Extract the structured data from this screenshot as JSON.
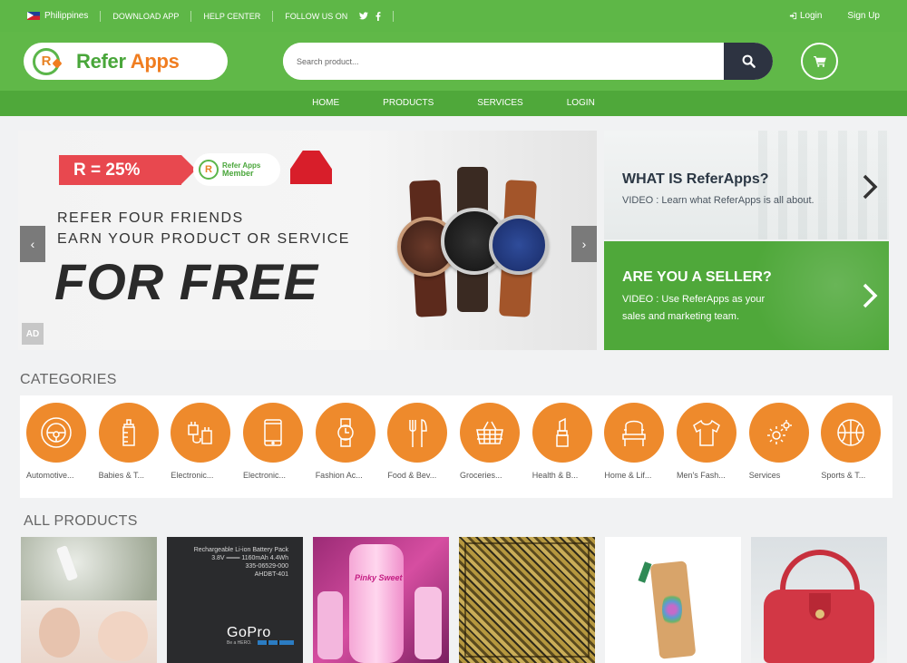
{
  "topbar": {
    "country": "Philippines",
    "download_app": "DOWNLOAD APP",
    "help_center": "HELP CENTER",
    "follow_us": "FOLLOW US ON",
    "twitter_icon": "twitter-icon",
    "facebook_icon": "facebook-icon",
    "login": "Login",
    "signup": "Sign Up"
  },
  "header": {
    "logo_refer": "Refer",
    "logo_apps": "Apps",
    "logo_mark": "R",
    "search_placeholder": "Search product...",
    "search_icon": "search-icon",
    "cart_icon": "cart-icon"
  },
  "nav": {
    "items": [
      "HOME",
      "PRODUCTS",
      "SERVICES",
      "LOGIN"
    ]
  },
  "banner": {
    "rate": "R = 25%",
    "member_line1": "Refer Apps",
    "member_line2": "Member",
    "line1": "REFER FOUR FRIENDS",
    "line2": "EARN YOUR PRODUCT OR SERVICE",
    "headline": "FOR FREE",
    "ad": "AD"
  },
  "side": {
    "what_title": "WHAT IS ReferApps?",
    "what_text": "VIDEO : Learn what ReferApps is all about.",
    "seller_title": "ARE YOU A SELLER?",
    "seller_text1": "VIDEO : Use ReferApps as your",
    "seller_text2": "sales and marketing team."
  },
  "categories": {
    "title": "CATEGORIES",
    "items": [
      {
        "label": "Automotive...",
        "icon": "steering-wheel-icon"
      },
      {
        "label": "Babies & T...",
        "icon": "baby-bottle-icon"
      },
      {
        "label": "Electronic...",
        "icon": "plug-icon"
      },
      {
        "label": "Electronic...",
        "icon": "tablet-icon"
      },
      {
        "label": "Fashion Ac...",
        "icon": "watch-icon"
      },
      {
        "label": "Food & Bev...",
        "icon": "fork-knife-icon"
      },
      {
        "label": "Groceries...",
        "icon": "basket-icon"
      },
      {
        "label": "Health & B...",
        "icon": "lipstick-icon"
      },
      {
        "label": "Home & Lif...",
        "icon": "chair-icon"
      },
      {
        "label": "Men's Fash...",
        "icon": "shirt-icon"
      },
      {
        "label": "Services",
        "icon": "gear-icon"
      },
      {
        "label": "Sports & T...",
        "icon": "ball-icon"
      }
    ]
  },
  "products": {
    "title": "ALL PRODUCTS",
    "battery_line1": "Rechargeable Li-ion Battery Pack",
    "battery_line2": "3.8V ═══ 1160mAh 4.4Wh",
    "battery_line3": "335-06529-000",
    "battery_line4": "AHDBT-401",
    "gopro": "GoPro",
    "be_hero": "Be a HERO.",
    "pinky": "Pinky Sweet"
  },
  "colors": {
    "green": "#5eb747",
    "dark_green": "#4fa83a",
    "orange": "#ee8a2c",
    "navy": "#2d3341"
  }
}
